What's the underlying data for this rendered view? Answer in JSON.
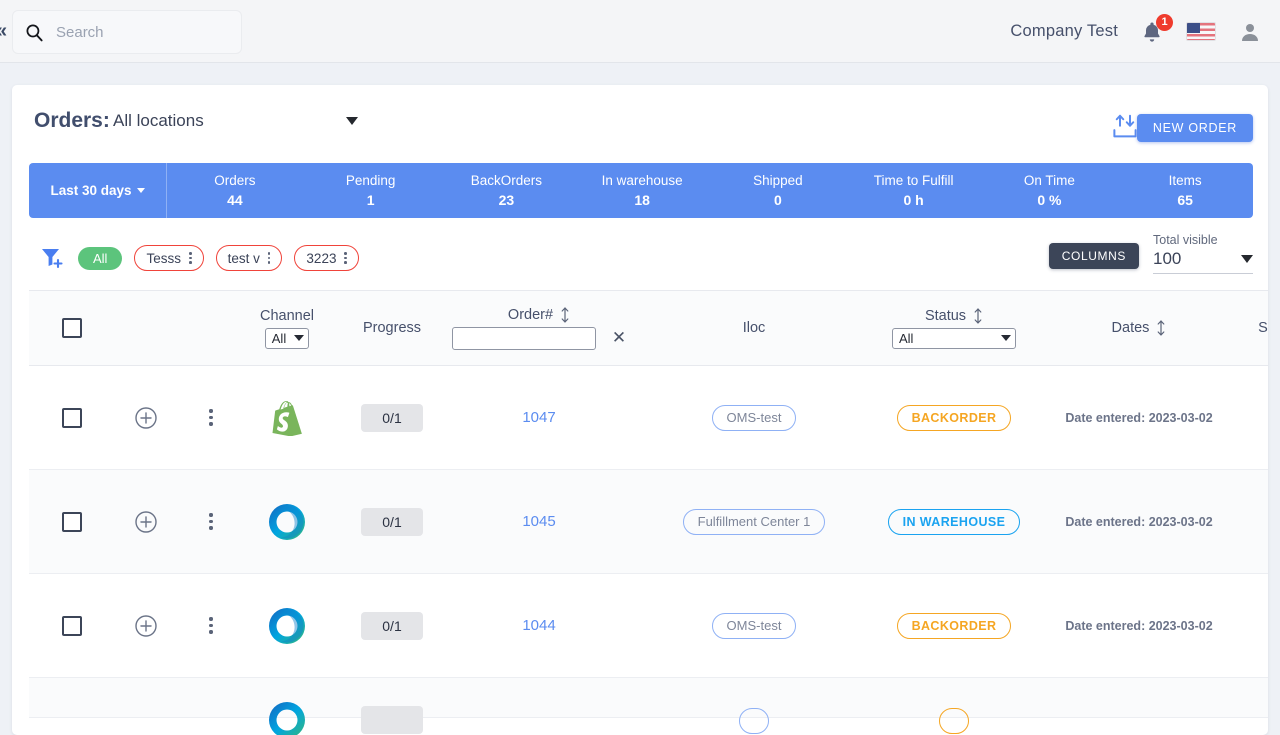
{
  "topbar": {
    "collapse_icon": "double-chevron-left-icon",
    "search": {
      "placeholder": "Search",
      "value": "",
      "icon": "search-icon"
    },
    "company": "Company Test",
    "notifications": {
      "icon": "bell-icon",
      "count": "1"
    },
    "locale_flag": "us-flag-icon",
    "account_icon": "user-avatar-icon"
  },
  "page": {
    "title": "Orders:",
    "location_filter": "All locations",
    "import_icon": "import-export-icon",
    "new_order_label": "NEW ORDER"
  },
  "stats": {
    "range_label": "Last 30 days",
    "items": [
      {
        "label": "Orders",
        "value": "44"
      },
      {
        "label": "Pending",
        "value": "1"
      },
      {
        "label": "BackOrders",
        "value": "23"
      },
      {
        "label": "In warehouse",
        "value": "18"
      },
      {
        "label": "Shipped",
        "value": "0"
      },
      {
        "label": "Time to Fulfill",
        "value": "0 h"
      },
      {
        "label": "On Time",
        "value": "0 %"
      },
      {
        "label": "Items",
        "value": "65"
      }
    ],
    "bar_color": "#5b8cf0"
  },
  "filters": {
    "add_filter_icon": "funnel-plus-icon",
    "all_chip": "All",
    "chips": [
      {
        "label": "Tesss"
      },
      {
        "label": "test v"
      },
      {
        "label": "3223"
      }
    ],
    "chip_border_color": "#f0433a",
    "all_chip_color": "#5cc47c"
  },
  "toolbar_right": {
    "columns_label": "COLUMNS",
    "total_visible_label": "Total visible",
    "total_visible_value": "100"
  },
  "table": {
    "headers": {
      "channel": "Channel",
      "channel_filter": "All",
      "progress": "Progress",
      "order": "Order#",
      "order_filter_value": "",
      "iloc": "Iloc",
      "status": "Status",
      "status_filter": "All",
      "dates": "Dates",
      "shipping": "Sh"
    },
    "rows": [
      {
        "channel_icon": "shopify-logo-icon",
        "progress": "0/1",
        "order": "1047",
        "iloc": "OMS-test",
        "status": "BACKORDER",
        "status_type": "backorder",
        "date": "Date entered: 2023-03-02"
      },
      {
        "channel_icon": "ring-logo-icon",
        "progress": "0/1",
        "order": "1045",
        "iloc": "Fulfillment Center 1",
        "status": "IN WAREHOUSE",
        "status_type": "warehouse",
        "date": "Date entered: 2023-03-02"
      },
      {
        "channel_icon": "ring-logo-icon",
        "progress": "0/1",
        "order": "1044",
        "iloc": "OMS-test",
        "status": "BACKORDER",
        "status_type": "backorder",
        "date": "Date entered: 2023-03-02"
      }
    ]
  }
}
